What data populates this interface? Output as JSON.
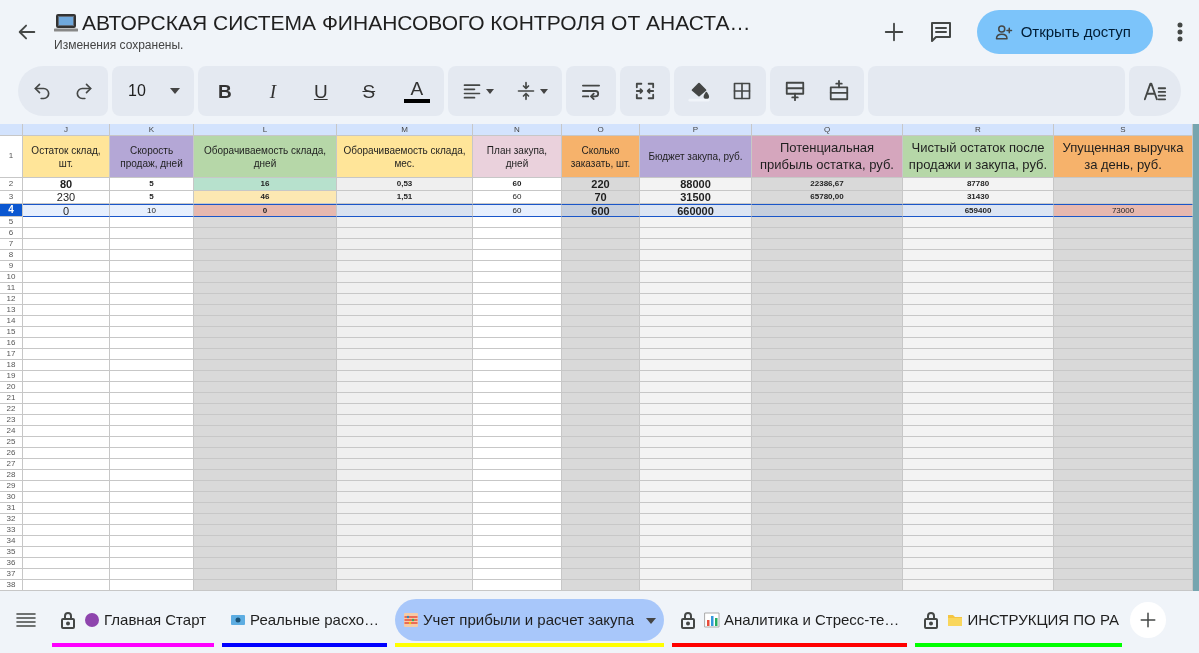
{
  "header": {
    "title": "АВТОРСКАЯ СИСТЕМА ФИНАНСОВОГО КОНТРОЛЯ ОТ АНАСТА…",
    "status": "Изменения сохранены.",
    "share_button": "Открыть доступ"
  },
  "toolbar": {
    "font_size": "10",
    "format_buttons": [
      "B",
      "I",
      "U",
      "S",
      "A"
    ]
  },
  "header_row_number": "1",
  "columns": [
    {
      "letter": "J",
      "header": "Остаток склад, шт.",
      "color": "#ffe599"
    },
    {
      "letter": "K",
      "header": "Скорость продаж, дней",
      "color": "#b4a7d6"
    },
    {
      "letter": "L",
      "header": "Оборачиваемость склада, дней",
      "color": "#b6d7a8"
    },
    {
      "letter": "M",
      "header": "Оборачиваемость склада, мес.",
      "color": "#ffe599"
    },
    {
      "letter": "N",
      "header": "План закупа, дней",
      "color": "#ead1dc"
    },
    {
      "letter": "O",
      "header": "Сколько заказать, шт.",
      "color": "#f6b26b"
    },
    {
      "letter": "P",
      "header": "Бюджет закупа, руб.",
      "color": "#b4a7d6"
    },
    {
      "letter": "Q",
      "header": "Потенциальная прибыль остатка, руб.",
      "color": "#d5a6bd"
    },
    {
      "letter": "R",
      "header": "Чистый остаток после продажи и закупа, руб.",
      "color": "#b6d7a8"
    },
    {
      "letter": "S",
      "header": "Упущенная выручка за день, руб.",
      "color": "#f6b26b"
    }
  ],
  "rows": [
    {
      "number": "2",
      "selected": false,
      "cells": [
        {
          "text": "80",
          "bold": true
        },
        {
          "text": "5",
          "bold": true
        },
        {
          "text": "16",
          "bold": true,
          "color": "#b7e1cd"
        },
        {
          "text": "0,53",
          "bold": true
        },
        {
          "text": "60",
          "bold": true
        },
        {
          "text": "220",
          "bold": true
        },
        {
          "text": "88000",
          "bold": true
        },
        {
          "text": "22386,67",
          "bold": true
        },
        {
          "text": "87780",
          "bold": true
        },
        {
          "text": "",
          "bold": false
        }
      ]
    },
    {
      "number": "3",
      "selected": false,
      "cells": [
        {
          "text": "230",
          "bold": false
        },
        {
          "text": "5",
          "bold": true
        },
        {
          "text": "46",
          "bold": true,
          "color": "#fce8b2"
        },
        {
          "text": "1,51",
          "bold": true
        },
        {
          "text": "60",
          "bold": false
        },
        {
          "text": "70",
          "bold": true
        },
        {
          "text": "31500",
          "bold": true
        },
        {
          "text": "65780,00",
          "bold": true
        },
        {
          "text": "31430",
          "bold": true
        },
        {
          "text": "",
          "bold": false
        }
      ]
    },
    {
      "number": "4",
      "selected": true,
      "cells": [
        {
          "text": "0",
          "bold": false
        },
        {
          "text": "10",
          "bold": false
        },
        {
          "text": "0",
          "bold": true,
          "color": "#e6b8af"
        },
        {
          "text": "",
          "bold": false
        },
        {
          "text": "60",
          "bold": false
        },
        {
          "text": "600",
          "bold": true
        },
        {
          "text": "660000",
          "bold": true
        },
        {
          "text": "",
          "bold": false
        },
        {
          "text": "659400",
          "bold": true
        },
        {
          "text": "73000",
          "bold": false,
          "color": "#e6b8af"
        }
      ]
    }
  ],
  "empty_rows": [
    "5",
    "6",
    "7",
    "8",
    "9",
    "10",
    "11",
    "12",
    "13",
    "14",
    "15",
    "16",
    "17",
    "18",
    "19",
    "20",
    "21",
    "22",
    "23",
    "24",
    "25",
    "26",
    "27",
    "28",
    "29",
    "30",
    "31",
    "32",
    "33",
    "34",
    "35",
    "36",
    "37",
    "38"
  ],
  "sheet_tabs": [
    {
      "label": "Главная Старт",
      "locked": true,
      "selected": false,
      "color": "#ff00ff"
    },
    {
      "label": "Реальные расхо…",
      "locked": false,
      "selected": false,
      "color": "#0000ff"
    },
    {
      "label": "Учет прибыли и расчет закупа",
      "locked": false,
      "selected": true,
      "color": "#ffff00"
    },
    {
      "label": "Аналитика и Стресс-те…",
      "locked": true,
      "selected": false,
      "color": "#ff0000"
    },
    {
      "label": "ИНСТРУКЦИЯ ПО РА",
      "locked": true,
      "selected": false,
      "color": "#00ff00"
    }
  ]
}
